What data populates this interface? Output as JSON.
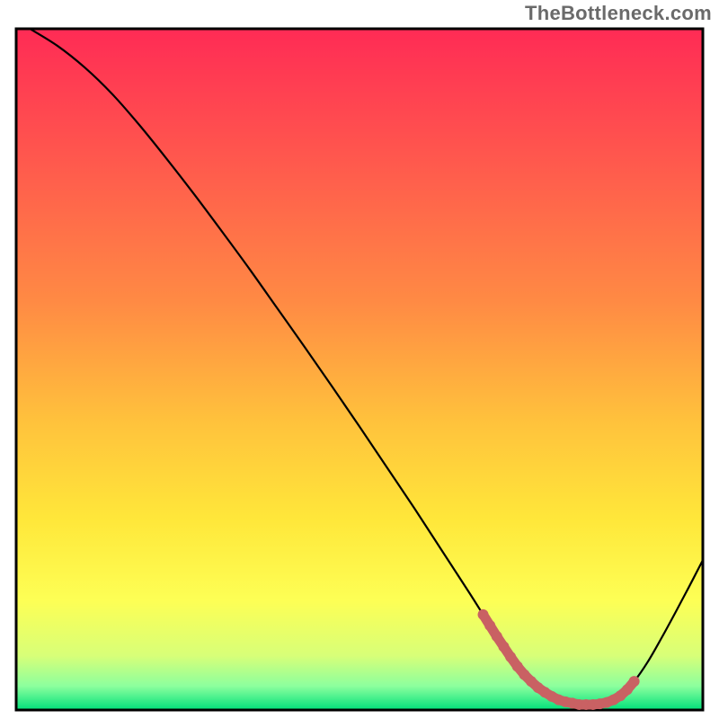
{
  "watermark": "TheBottleneck.com",
  "colors": {
    "frame_black": "#000000",
    "marker_stroke": "#c96163",
    "marker_fill": "#c96163",
    "gradient_stops": [
      {
        "offset": 0.0,
        "color": "#ff2b55"
      },
      {
        "offset": 0.2,
        "color": "#ff5a4d"
      },
      {
        "offset": 0.4,
        "color": "#ff8a44"
      },
      {
        "offset": 0.58,
        "color": "#ffc33c"
      },
      {
        "offset": 0.72,
        "color": "#ffe73a"
      },
      {
        "offset": 0.84,
        "color": "#fdff55"
      },
      {
        "offset": 0.92,
        "color": "#d8ff78"
      },
      {
        "offset": 0.965,
        "color": "#8cff9e"
      },
      {
        "offset": 1.0,
        "color": "#00e07a"
      }
    ]
  },
  "chart_data": {
    "type": "line",
    "title": "",
    "xlabel": "",
    "ylabel": "",
    "xlim": [
      0,
      100
    ],
    "ylim": [
      0,
      100
    ],
    "grid": false,
    "legend": false,
    "x": [
      2,
      6,
      10,
      14,
      18,
      22,
      26,
      30,
      34,
      38,
      42,
      46,
      50,
      54,
      58,
      62,
      66,
      68,
      70,
      72,
      74,
      76,
      78,
      80,
      82,
      84,
      86,
      88,
      90,
      92,
      94,
      96,
      98,
      100
    ],
    "series": [
      {
        "name": "curve",
        "values": [
          100,
          97.5,
          94.3,
          90.4,
          85.8,
          80.8,
          75.6,
          70.2,
          64.7,
          59.0,
          53.3,
          47.5,
          41.6,
          35.6,
          29.6,
          23.4,
          17.2,
          14.0,
          10.8,
          7.8,
          5.2,
          3.3,
          2.0,
          1.2,
          0.8,
          0.8,
          1.1,
          2.1,
          4.2,
          7.1,
          10.6,
          14.3,
          18.1,
          22.0
        ]
      }
    ],
    "markers": {
      "range_percent_x": [
        68,
        90
      ],
      "points": [
        {
          "x": 68.0,
          "y": 14.0
        },
        {
          "x": 69.0,
          "y": 12.4
        },
        {
          "x": 70.0,
          "y": 10.8
        },
        {
          "x": 71.0,
          "y": 9.3
        },
        {
          "x": 72.0,
          "y": 7.8
        },
        {
          "x": 73.0,
          "y": 6.4
        },
        {
          "x": 74.0,
          "y": 5.2
        },
        {
          "x": 75.0,
          "y": 4.2
        },
        {
          "x": 76.0,
          "y": 3.3
        },
        {
          "x": 77.0,
          "y": 2.6
        },
        {
          "x": 78.0,
          "y": 2.0
        },
        {
          "x": 79.0,
          "y": 1.5
        },
        {
          "x": 80.0,
          "y": 1.2
        },
        {
          "x": 81.0,
          "y": 1.0
        },
        {
          "x": 82.0,
          "y": 0.8
        },
        {
          "x": 83.0,
          "y": 0.8
        },
        {
          "x": 84.0,
          "y": 0.8
        },
        {
          "x": 85.0,
          "y": 0.9
        },
        {
          "x": 86.0,
          "y": 1.1
        },
        {
          "x": 87.0,
          "y": 1.5
        },
        {
          "x": 88.0,
          "y": 2.1
        },
        {
          "x": 89.0,
          "y": 3.0
        },
        {
          "x": 90.0,
          "y": 4.2
        }
      ]
    }
  }
}
